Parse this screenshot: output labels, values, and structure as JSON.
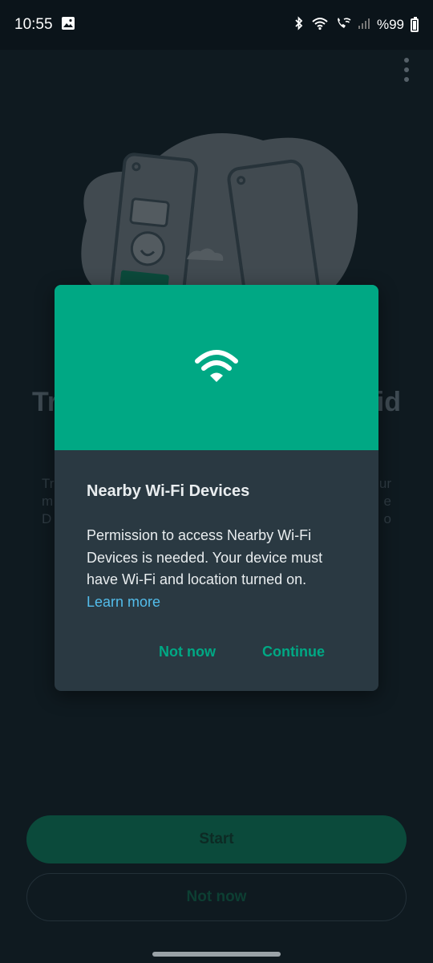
{
  "status_bar": {
    "time": "10:55",
    "battery_text": "%99"
  },
  "background_screen": {
    "title_left": "Tr",
    "title_right": "id",
    "body_left_lines": [
      "Tr",
      "m",
      "D"
    ],
    "body_right_lines": [
      "ur",
      "e",
      "o"
    ],
    "start_label": "Start",
    "not_now_label": "Not now"
  },
  "dialog": {
    "title": "Nearby Wi-Fi Devices",
    "message": "Permission to access Nearby Wi-Fi Devices is needed. Your device must have Wi-Fi and location turned on.",
    "learn_more": "Learn more",
    "not_now_label": "Not now",
    "continue_label": "Continue",
    "accent_color": "#00a884",
    "icon": "wifi-icon"
  }
}
